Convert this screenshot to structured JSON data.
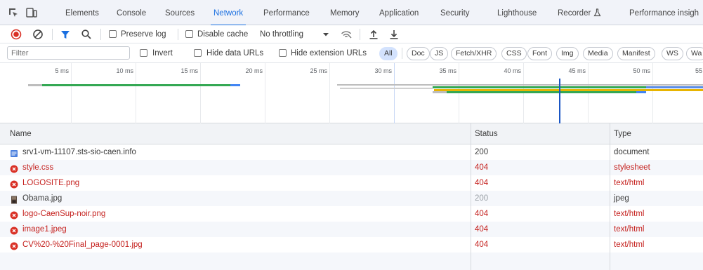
{
  "tabs": [
    {
      "label": "Elements",
      "active": false
    },
    {
      "label": "Console",
      "active": false
    },
    {
      "label": "Sources",
      "active": false
    },
    {
      "label": "Network",
      "active": true
    },
    {
      "label": "Performance",
      "active": false
    },
    {
      "label": "Memory",
      "active": false
    },
    {
      "label": "Application",
      "active": false
    },
    {
      "label": "Security",
      "active": false
    },
    {
      "label": "Lighthouse",
      "active": false
    },
    {
      "label": "Recorder",
      "active": false
    },
    {
      "label": "Performance insigh",
      "active": false
    }
  ],
  "toolbar": {
    "preserve_log": "Preserve log",
    "disable_cache": "Disable cache",
    "throttling": "No throttling"
  },
  "filterbar": {
    "placeholder": "Filter",
    "invert": "Invert",
    "hide_data_urls": "Hide data URLs",
    "hide_extension_urls": "Hide extension URLs",
    "types": [
      "All",
      "Doc",
      "JS",
      "Fetch/XHR",
      "CSS",
      "Font",
      "Img",
      "Media",
      "Manifest",
      "WS",
      "Wa"
    ],
    "active_type": "All"
  },
  "timeline": {
    "ticks": [
      "5 ms",
      "10 ms",
      "15 ms",
      "20 ms",
      "25 ms",
      "30 ms",
      "35 ms",
      "40 ms",
      "45 ms",
      "50 ms",
      "55"
    ]
  },
  "table": {
    "headers": {
      "name": "Name",
      "status": "Status",
      "type": "Type"
    },
    "rows": [
      {
        "name": "srv1-vm-11107.sts-sio-caen.info",
        "status": "200",
        "type": "document",
        "kind": "doc",
        "error": false
      },
      {
        "name": "style.css",
        "status": "404",
        "type": "stylesheet",
        "kind": "error",
        "error": true
      },
      {
        "name": "LOGOSITE.png",
        "status": "404",
        "type": "text/html",
        "kind": "error",
        "error": true
      },
      {
        "name": "Obama.jpg",
        "status": "200",
        "type": "jpeg",
        "kind": "image",
        "error": false
      },
      {
        "name": "logo-CaenSup-noir.png",
        "status": "404",
        "type": "text/html",
        "kind": "error",
        "error": true
      },
      {
        "name": "image1.jpeg",
        "status": "404",
        "type": "text/html",
        "kind": "error",
        "error": true
      },
      {
        "name": "CV%20-%20Final_page-0001.jpg",
        "status": "404",
        "type": "text/html",
        "kind": "error",
        "error": true
      }
    ]
  },
  "colors": {
    "accent": "#1a6fe0",
    "error": "#c5221f",
    "record": "#d93025"
  }
}
